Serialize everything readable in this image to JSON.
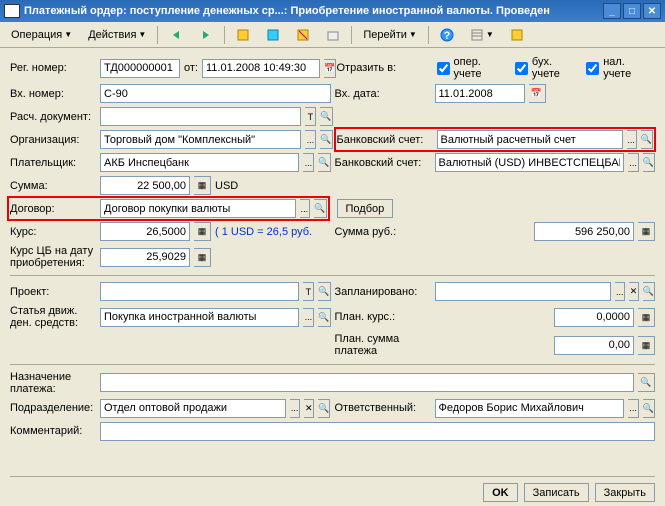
{
  "window": {
    "title": "Платежный ордер: поступление денежных ср...: Приобретение иностранной валюты. Проведен"
  },
  "toolbar": {
    "operation": "Операция",
    "actions": "Действия",
    "goto": "Перейти"
  },
  "labels": {
    "reg_num": "Рег. номер:",
    "ot": "от:",
    "reflect": "Отразить в:",
    "oper": "опер. учете",
    "buh": "бух. учете",
    "nal": "нал. учете",
    "vh_num": "Вх. номер:",
    "vh_date": "Вх. дата:",
    "rasch_doc": "Расч. документ:",
    "org": "Организация:",
    "bank1": "Банковский счет:",
    "payer": "Плательщик:",
    "bank2": "Банковский счет:",
    "summa": "Сумма:",
    "dogovor": "Договор:",
    "podbor": "Подбор",
    "kurs": "Курс:",
    "kurs_hint": "( 1 USD = 26,5 руб.",
    "summa_rub": "Сумма руб.:",
    "kurs_cb": "Курс ЦБ на дату приобретения:",
    "proekt": "Проект:",
    "zaplan": "Запланировано:",
    "statya": "Статья движ. ден. средств:",
    "plan_kurs": "План. курс.:",
    "plan_summa": "План. сумма платежа",
    "nazn": "Назначение платежа:",
    "podrazd": "Подразделение:",
    "otv": "Ответственный:",
    "komment": "Комментарий:"
  },
  "values": {
    "reg_num": "ТД000000001",
    "date": "11.01.2008 10:49:30",
    "vh_num": "С-90",
    "vh_date": "11.01.2008",
    "org": "Торговый дом \"Комплексный\"",
    "bank1": "Валютный расчетный счет",
    "payer": "АКБ Инспецбанк",
    "bank2": "Валютный (USD) ИНВЕСТСПЕЦБАНК",
    "summa": "22 500,00",
    "currency": "USD",
    "dogovor": "Договор покупки валюты",
    "kurs": "26,5000",
    "summa_rub": "596 250,00",
    "kurs_cb": "25,9029",
    "statya": "Покупка иностранной валюты",
    "plan_kurs": "0,0000",
    "plan_summa": "0,00",
    "podrazd": "Отдел оптовой продажи",
    "otv": "Федоров Борис Михайлович"
  },
  "footer": {
    "ok": "OK",
    "save": "Записать",
    "close": "Закрыть"
  }
}
